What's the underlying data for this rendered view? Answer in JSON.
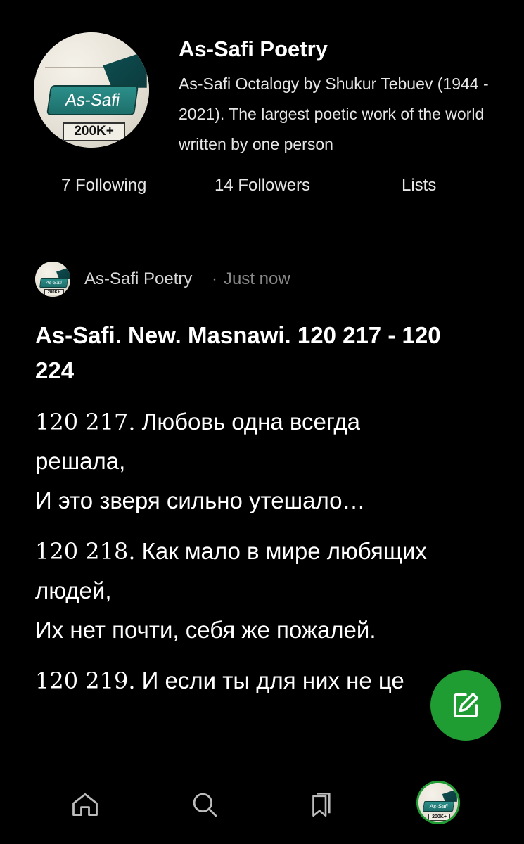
{
  "profile": {
    "name": "As-Safi Poetry",
    "bio": "As-Safi Octalogy by Shukur Tebuev (1944 - 2021). The largest poetic work of the world written by one person",
    "avatar": {
      "label": "As-Safi",
      "count": "200K+"
    },
    "stats": {
      "following": "7 Following",
      "followers": "14 Followers",
      "lists": "Lists"
    }
  },
  "post": {
    "author": "As-Safi Poetry",
    "separator": "·",
    "time": "Just now",
    "title": "As-Safi. New. Masnawi. 120 217 - 120 224",
    "stanzas": [
      {
        "number": "120 217.",
        "lines": [
          "Любовь одна всегда",
          "решала,",
          "И это зверя сильно утешало…"
        ]
      },
      {
        "number": "120 218.",
        "lines": [
          "Как мало в мире любящих",
          "людей,",
          "Их нет почти, себя же пожалей."
        ]
      },
      {
        "number": "120 219.",
        "lines": [
          "И если ты для них не це"
        ]
      }
    ]
  },
  "fab": {
    "icon": "edit-icon"
  },
  "nav": {
    "icons": [
      "home-icon",
      "search-icon",
      "bookmarks-icon",
      "profile-avatar"
    ]
  },
  "colors": {
    "background": "#000000",
    "accent": "#1f9d32",
    "muted": "#8a8a8a"
  }
}
